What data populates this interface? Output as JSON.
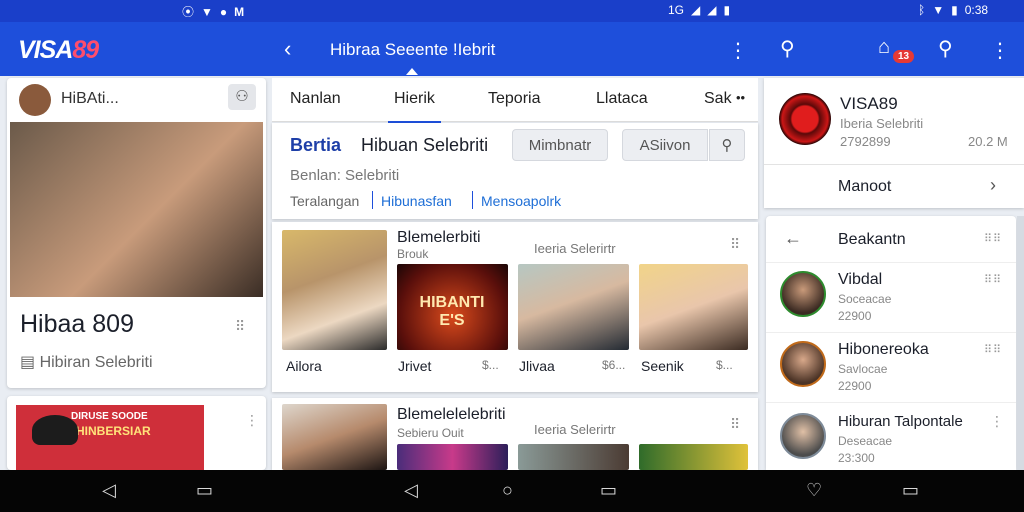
{
  "status": {
    "left_icons": [
      "location-icon",
      "wifi-icon",
      "drop-icon",
      "m-icon"
    ],
    "right_text": "0:38"
  },
  "appbar": {
    "logo_a": "VISA",
    "logo_b": "89",
    "title": "Hibraa Seeente !Iebrit",
    "badge": "13"
  },
  "left": {
    "top_label": "HiBAti...",
    "profile_title": "Hibaa 809",
    "profile_sub": "Hibiran Selebriti",
    "banner_text_1": "DIRUSE SOODE",
    "banner_text_2": "HINBERSIAR"
  },
  "middle": {
    "tabs": [
      "Nanlan",
      "Hierik",
      "Teporia",
      "Llataca",
      "Sak"
    ],
    "heading_a": "Bertia",
    "heading_b": "Hibuan Selebriti",
    "btn1": "Mimbnatr",
    "btn2": "ASiivon",
    "subtitle": "Benlan: Selebriti",
    "links": [
      "Teralangan",
      "Hibunasfan",
      "Mensoapolrk"
    ],
    "section1": {
      "title": "Blemelerbiti",
      "sub": "Brouk",
      "mid": "Ieeria Selerirtr",
      "poster_text": "HIBANTI E'S",
      "captions": [
        "Ailora",
        "Jrivet",
        "$...",
        "Jlivaa",
        "$6...",
        "Seenik",
        "$..."
      ]
    },
    "section2": {
      "title": "Blemelelelebriti",
      "sub": "Sebieru Ouit",
      "mid": "Ieeria Selerirtr"
    }
  },
  "right": {
    "brand": "VISA89",
    "brand_sub": "Iberia Selebriti",
    "brand_num": "2792899",
    "brand_num2": "20.2 M",
    "nav_label": "Manoot",
    "list_header": "Beakantn",
    "items": [
      {
        "name": "Vibdal",
        "sub": "Soceacae",
        "num": "22900"
      },
      {
        "name": "Hibonereoka",
        "sub": "Savlocae",
        "num": "22900"
      },
      {
        "name": "Hiburan Talpontale",
        "sub": "Deseacae",
        "num": "23:300"
      }
    ]
  }
}
